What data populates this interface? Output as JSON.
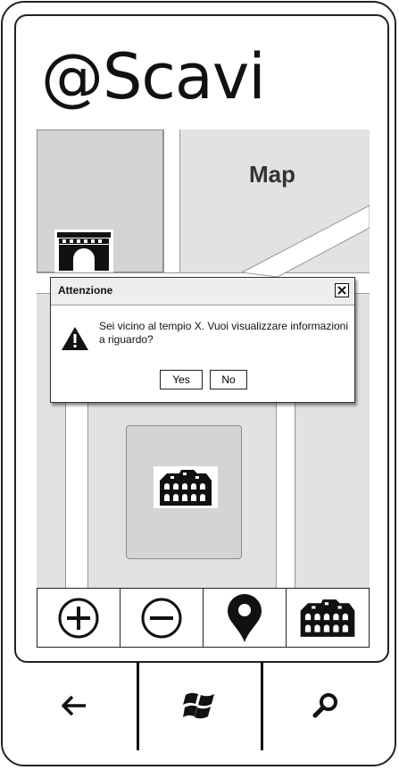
{
  "app": {
    "title": "@Scavi"
  },
  "map": {
    "label": "Map"
  },
  "dialog": {
    "title": "Attenzione",
    "message": "Sei vicino al tempio X. Vuoi visualizzare informazioni a riguardo?",
    "yes_label": "Yes",
    "no_label": "No"
  },
  "toolbar": {
    "items": [
      "zoom-in-icon",
      "zoom-out-icon",
      "location-pin-icon",
      "colosseum-icon"
    ]
  },
  "hardware_buttons": [
    "back-arrow-icon",
    "windows-logo-icon",
    "search-icon"
  ]
}
